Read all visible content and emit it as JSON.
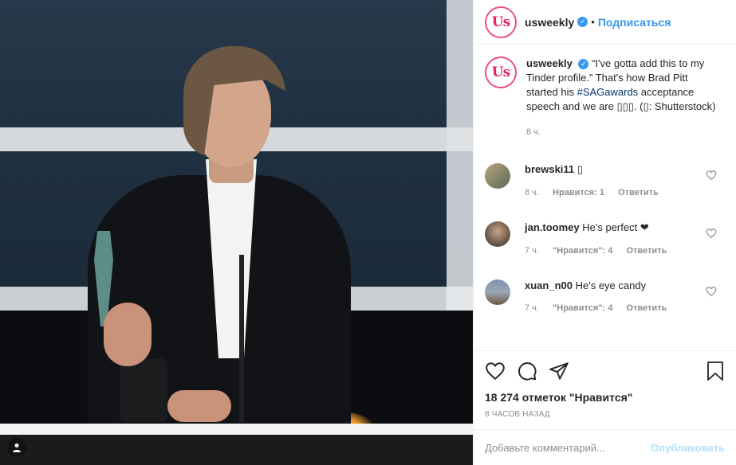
{
  "post": {
    "image_alt": "Brad Pitt SAG awards photo",
    "corner_badge_icon": "user-icon"
  },
  "header": {
    "username": "usweekly",
    "logo_text": "Us",
    "separator": "•",
    "follow_label": "Подписаться"
  },
  "caption": {
    "username": "usweekly",
    "text_before": "“I've gotta add this to my Tinder profile.” That's how Brad Pitt started his ",
    "hashtag": "#SAGawards",
    "text_after": " acceptance speech and we are ▯▯▯. (▯: Shutterstock)",
    "time": "8 ч."
  },
  "comments": [
    {
      "username": "brewski11",
      "text": "▯",
      "time": "8 ч.",
      "likes": "Нравится: 1",
      "reply": "Ответить",
      "avatar_color": "#8a8a7a"
    },
    {
      "username": "jan.toomey",
      "text": "He's perfect ❤",
      "time": "7 ч.",
      "likes": "\"Нравится\": 4",
      "reply": "Ответить",
      "avatar_color": "#6e5a48"
    },
    {
      "username": "xuan_n00",
      "text": "He's eye candy",
      "time": "7 ч.",
      "likes": "\"Нравится\": 4",
      "reply": "Ответить",
      "avatar_color": "#5f6f86"
    }
  ],
  "actions": {
    "likes_count": "18 274 отметок \"Нравится\"",
    "posted_ago": "8 ЧАСОВ НАЗАД"
  },
  "comment_box": {
    "placeholder": "Добавьте комментарий...",
    "publish_label": "Опубликовать"
  },
  "colors": {
    "accent": "#3897f0",
    "brand": "#e3216d",
    "muted": "#8e8e8e",
    "publish_disabled": "#b2dffc"
  }
}
